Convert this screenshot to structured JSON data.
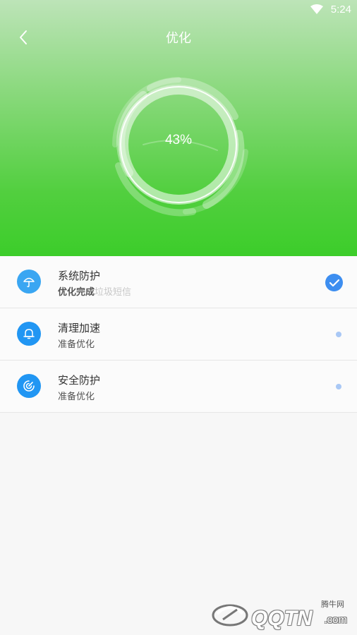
{
  "status_bar": {
    "time": "5:24"
  },
  "header": {
    "title": "优化",
    "progress_text": "43%",
    "progress_value": 0.43
  },
  "items": [
    {
      "title": "系统防护",
      "subtitle_main": "优化完成",
      "subtitle_extra": "垃圾短信",
      "icon": "umbrella-icon",
      "status": "check-icon"
    },
    {
      "title": "清理加速",
      "subtitle_main": "准备优化",
      "subtitle_extra": "",
      "icon": "bell-icon",
      "status": "pending-dot-icon"
    },
    {
      "title": "安全防护",
      "subtitle_main": "准备优化",
      "subtitle_extra": "",
      "icon": "shield-circle-icon",
      "status": "pending-dot-icon"
    }
  ],
  "watermark": {
    "label": "腾牛网",
    "brand": "QQTN",
    "domain": ".com"
  },
  "colors": {
    "header_top": "#bde4b8",
    "header_bottom": "#3ccd2a",
    "icon_blue": "#3aa6f2",
    "check_blue": "#3d8ef0",
    "pending_dot": "#a9c8f5"
  }
}
